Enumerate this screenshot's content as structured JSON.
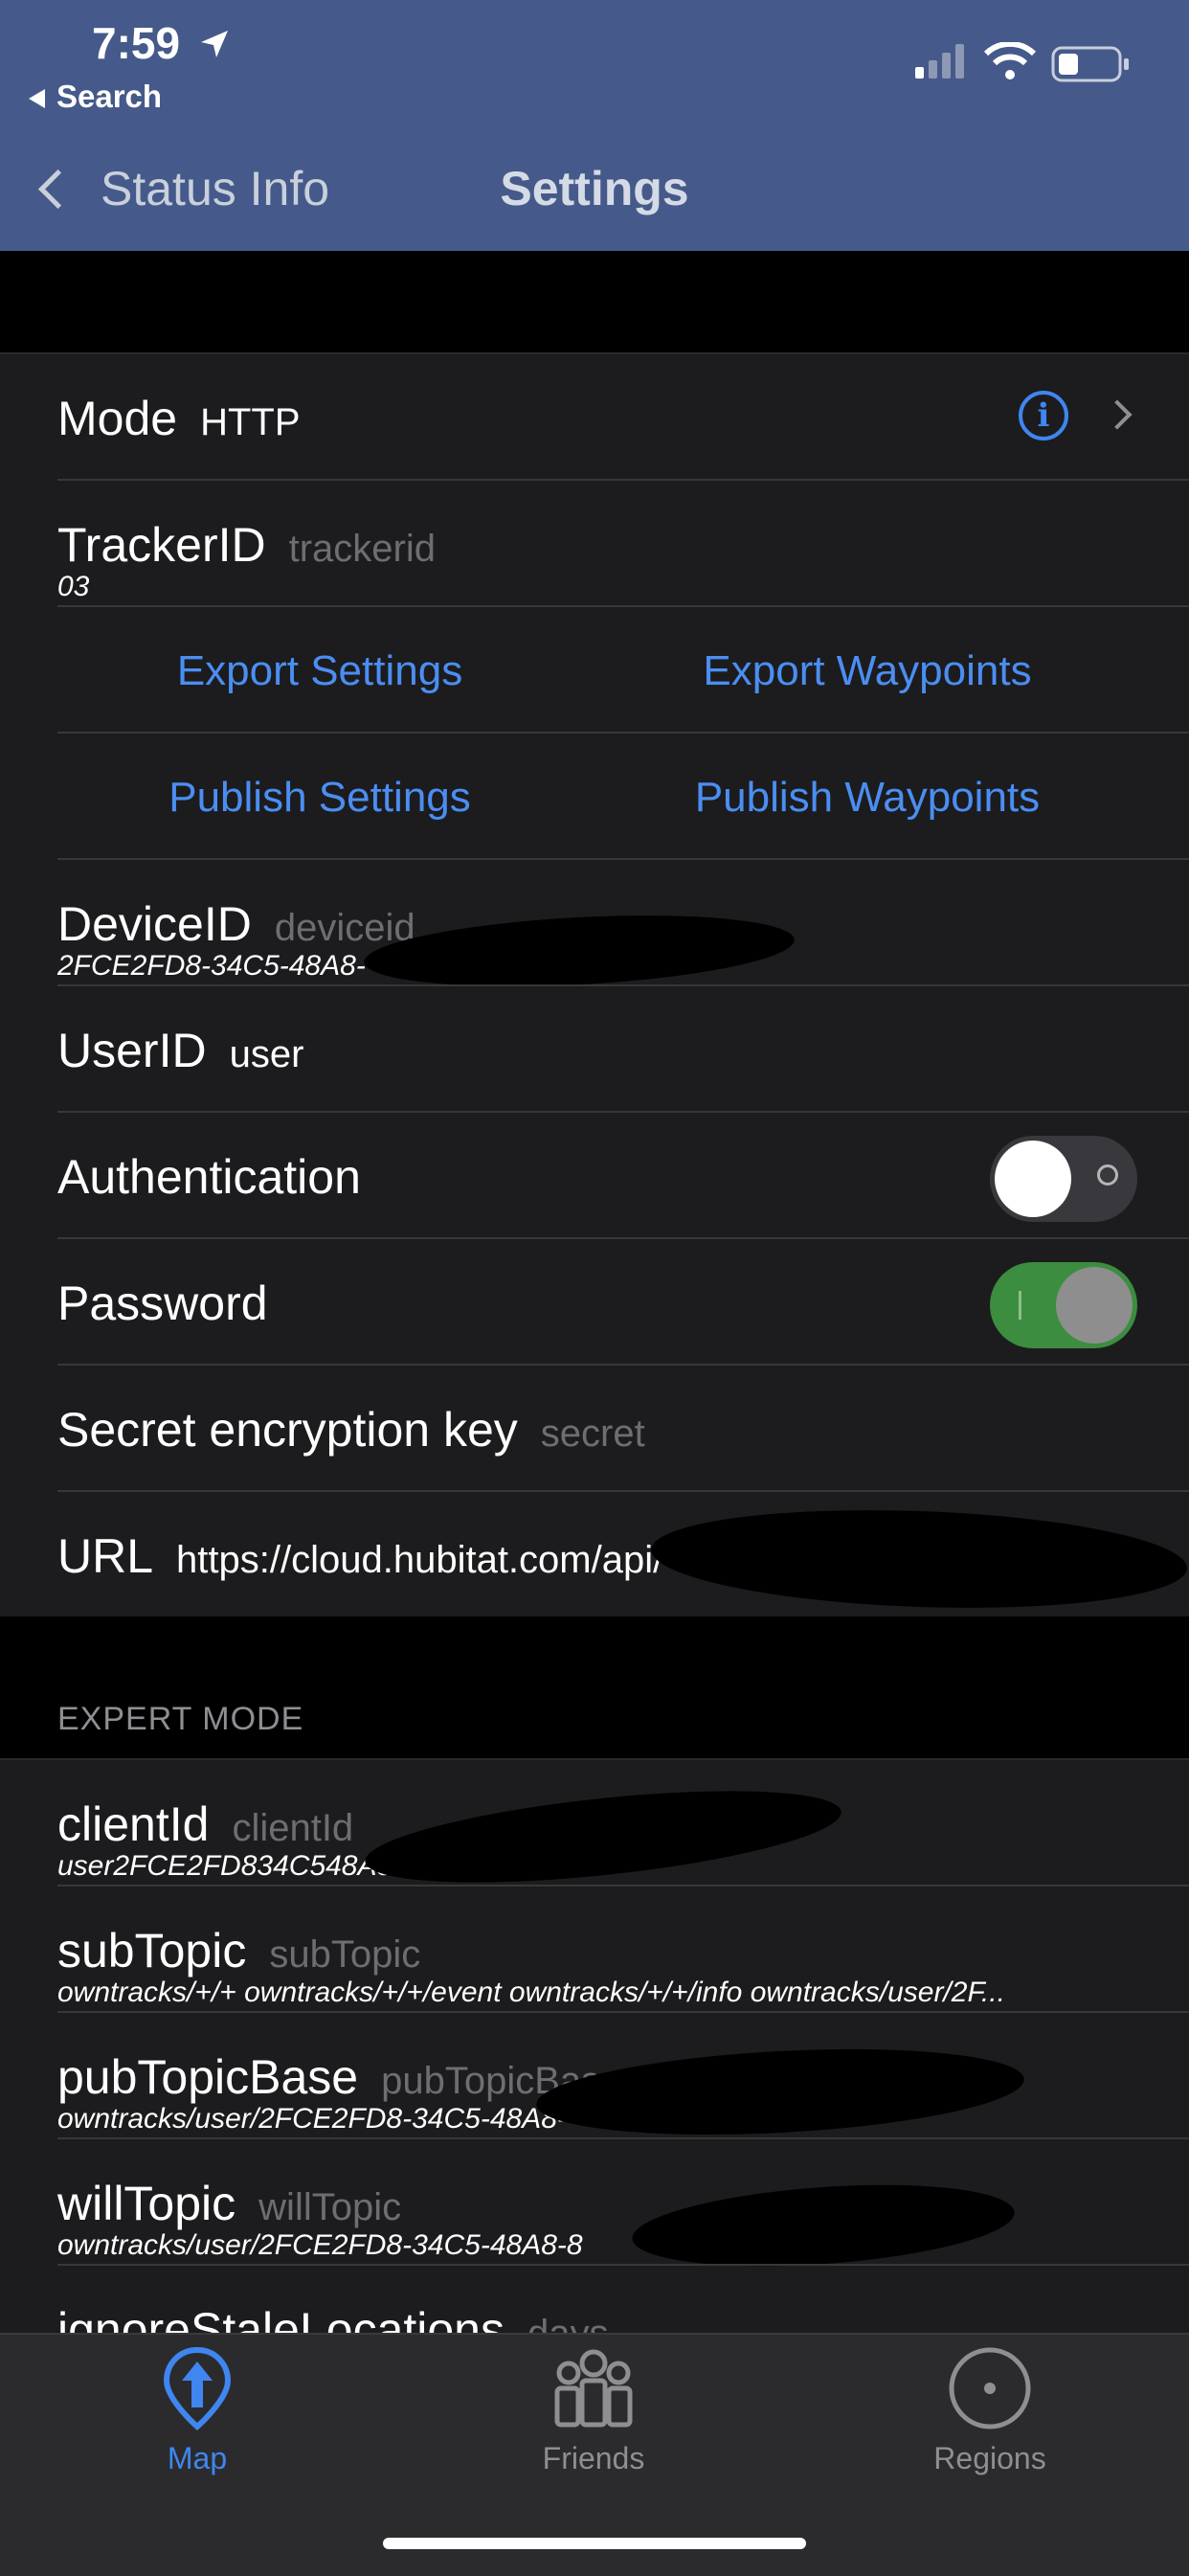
{
  "status_bar": {
    "time": "7:59",
    "back_app": "Search"
  },
  "nav": {
    "back_label": "Status Info",
    "title": "Settings"
  },
  "settings": {
    "mode": {
      "label": "Mode",
      "value": "HTTP"
    },
    "tracker_id": {
      "label": "TrackerID",
      "placeholder": "trackerid",
      "value": "03"
    },
    "export_settings": "Export Settings",
    "export_waypoints": "Export Waypoints",
    "publish_settings": "Publish Settings",
    "publish_waypoints": "Publish Waypoints",
    "device_id": {
      "label": "DeviceID",
      "placeholder": "deviceid",
      "value": "2FCE2FD8-34C5-48A8-"
    },
    "user_id": {
      "label": "UserID",
      "value": "user"
    },
    "authentication": {
      "label": "Authentication",
      "on": false
    },
    "password": {
      "label": "Password",
      "on": true
    },
    "secret": {
      "label": "Secret encryption key",
      "placeholder": "secret"
    },
    "url": {
      "label": "URL",
      "value": "https://cloud.hubitat.com/api/"
    }
  },
  "expert": {
    "header": "EXPERT MODE",
    "client_id": {
      "label": "clientId",
      "placeholder": "clientId",
      "value": "user2FCE2FD834C548A8"
    },
    "sub_topic": {
      "label": "subTopic",
      "placeholder": "subTopic",
      "value": "owntracks/+/+ owntracks/+/+/event owntracks/+/+/info owntracks/user/2F..."
    },
    "pub_topic_base": {
      "label": "pubTopicBase",
      "placeholder": "pubTopicBase",
      "value": "owntracks/user/2FCE2FD8-34C5-48A8-"
    },
    "will_topic": {
      "label": "willTopic",
      "placeholder": "willTopic",
      "value": "owntracks/user/2FCE2FD8-34C5-48A8-8"
    },
    "ignore_stale": {
      "label": "ignoreStaleLocations",
      "placeholder": "days"
    }
  },
  "tabs": [
    {
      "label": "Map",
      "icon": "map-pin-icon",
      "active": true
    },
    {
      "label": "Friends",
      "icon": "friends-icon",
      "active": false
    },
    {
      "label": "Regions",
      "icon": "regions-icon",
      "active": false
    }
  ],
  "colors": {
    "accent": "#4b8ef2",
    "header": "#455a8a",
    "toggle_on": "#3c8d3f"
  }
}
